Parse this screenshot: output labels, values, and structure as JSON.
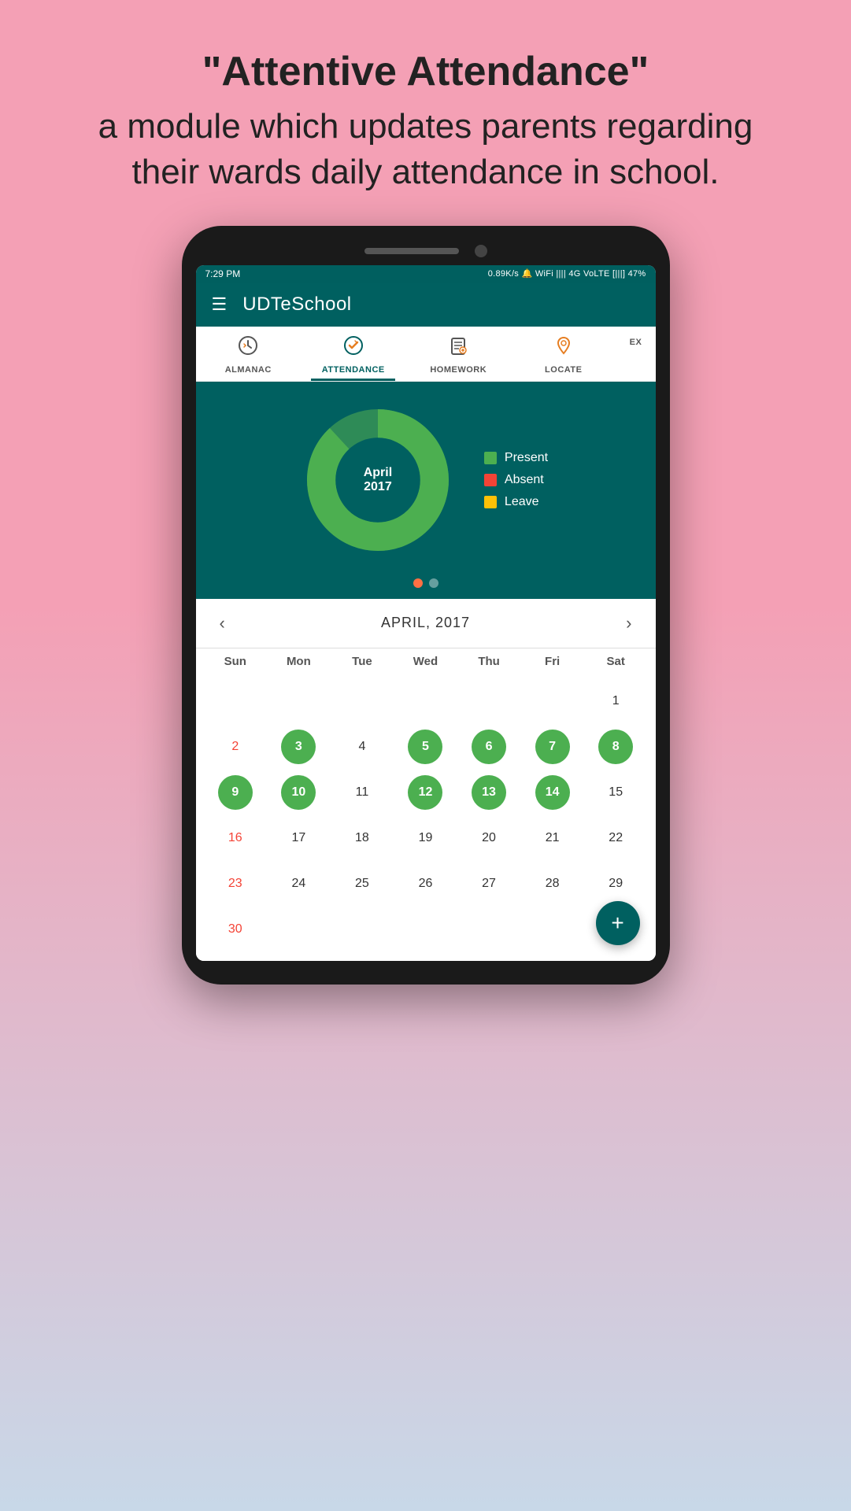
{
  "promo": {
    "title": "\"Attentive Attendance\"",
    "subtitle": "a module which updates parents regarding their wards daily attendance in school."
  },
  "status_bar": {
    "left": "7:29 PM",
    "right": "0.89K/s  🔔  WiFi  ||||  4G VoLTE  [|||]  47%"
  },
  "header": {
    "title": "UDTeSchool",
    "menu_icon": "☰"
  },
  "tabs": [
    {
      "label": "ALMANAC",
      "icon": "🕐",
      "active": false
    },
    {
      "label": "ATTENDANCE",
      "icon": "✅",
      "active": true
    },
    {
      "label": "HOMEWORK",
      "icon": "📋",
      "active": false
    },
    {
      "label": "LOCATE",
      "icon": "📍",
      "active": false
    },
    {
      "label": "EX",
      "icon": "",
      "active": false,
      "partial": true
    }
  ],
  "donut": {
    "month": "April",
    "year": "2017",
    "legend": [
      {
        "label": "Present",
        "color": "present"
      },
      {
        "label": "Absent",
        "color": "absent"
      },
      {
        "label": "Leave",
        "color": "leave"
      }
    ]
  },
  "carousel": {
    "active_dot": 0,
    "total_dots": 2
  },
  "calendar": {
    "nav_title": "APRIL, 2017",
    "prev_arrow": "‹",
    "next_arrow": "›",
    "headers": [
      "Sun",
      "Mon",
      "Tue",
      "Wed",
      "Thu",
      "Fri",
      "Sat"
    ],
    "rows": [
      [
        {
          "day": "",
          "type": "empty"
        },
        {
          "day": "",
          "type": "empty"
        },
        {
          "day": "",
          "type": "empty"
        },
        {
          "day": "",
          "type": "empty"
        },
        {
          "day": "",
          "type": "empty"
        },
        {
          "day": "",
          "type": "empty"
        },
        {
          "day": "1",
          "type": "normal"
        }
      ],
      [
        {
          "day": "2",
          "type": "sunday"
        },
        {
          "day": "3",
          "type": "present"
        },
        {
          "day": "4",
          "type": "normal"
        },
        {
          "day": "5",
          "type": "present"
        },
        {
          "day": "6",
          "type": "present"
        },
        {
          "day": "7",
          "type": "present"
        },
        {
          "day": "8",
          "type": "present"
        }
      ],
      [
        {
          "day": "9",
          "type": "present"
        },
        {
          "day": "10",
          "type": "present"
        },
        {
          "day": "11",
          "type": "normal"
        },
        {
          "day": "12",
          "type": "present"
        },
        {
          "day": "13",
          "type": "present"
        },
        {
          "day": "14",
          "type": "present"
        },
        {
          "day": "15",
          "type": "normal"
        }
      ],
      [
        {
          "day": "16",
          "type": "sunday"
        },
        {
          "day": "17",
          "type": "normal"
        },
        {
          "day": "18",
          "type": "normal"
        },
        {
          "day": "19",
          "type": "normal"
        },
        {
          "day": "20",
          "type": "normal"
        },
        {
          "day": "21",
          "type": "normal"
        },
        {
          "day": "22",
          "type": "normal"
        }
      ],
      [
        {
          "day": "23",
          "type": "sunday"
        },
        {
          "day": "24",
          "type": "normal"
        },
        {
          "day": "25",
          "type": "normal"
        },
        {
          "day": "26",
          "type": "normal"
        },
        {
          "day": "27",
          "type": "normal"
        },
        {
          "day": "28",
          "type": "normal"
        },
        {
          "day": "29",
          "type": "normal"
        }
      ],
      [
        {
          "day": "30",
          "type": "sunday"
        },
        {
          "day": "",
          "type": "empty"
        },
        {
          "day": "",
          "type": "empty"
        },
        {
          "day": "",
          "type": "empty"
        },
        {
          "day": "",
          "type": "empty"
        },
        {
          "day": "",
          "type": "empty"
        },
        {
          "day": "",
          "type": "empty"
        }
      ]
    ]
  },
  "fab": {
    "icon": "+"
  }
}
